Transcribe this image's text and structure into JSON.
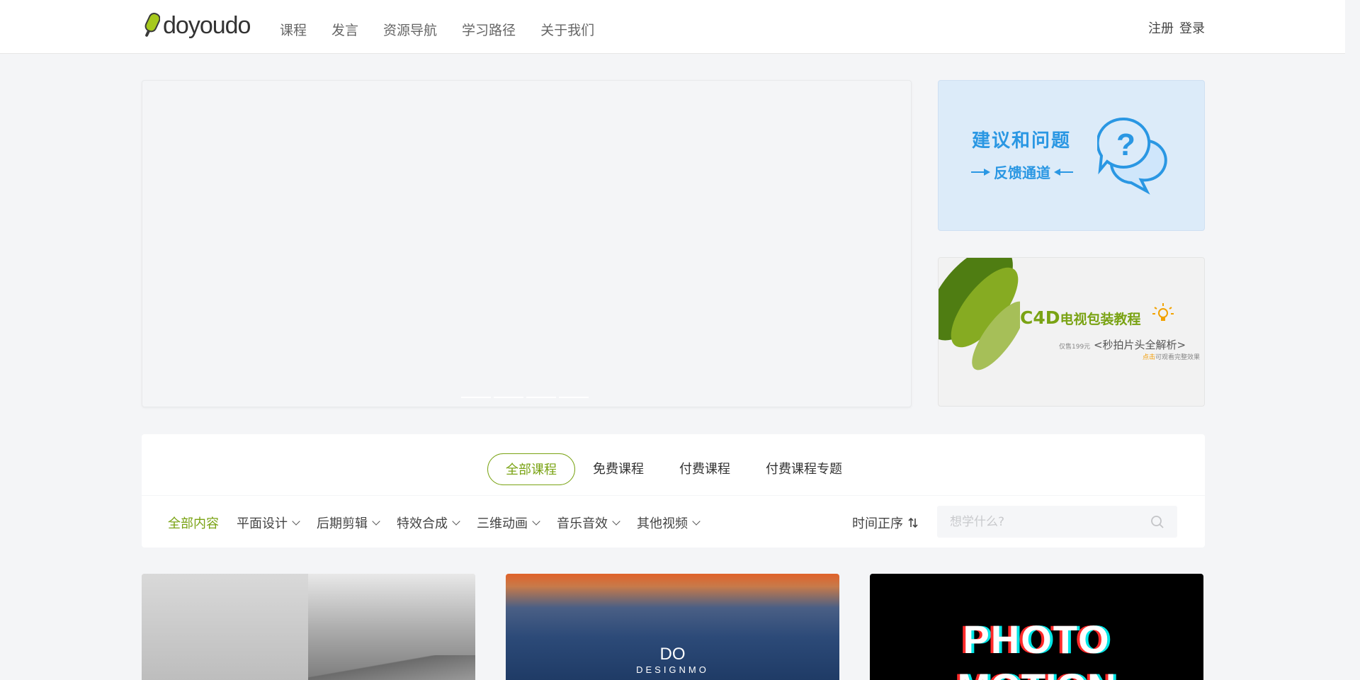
{
  "brand": {
    "logo_text": "doyoudo",
    "accent": "#7aa314"
  },
  "nav": {
    "items": [
      "课程",
      "发言",
      "资源导航",
      "学习路径",
      "关于我们"
    ]
  },
  "auth": {
    "register": "注册",
    "login": "登录"
  },
  "side_ads": {
    "feedback": {
      "title": "建议和问题",
      "subtitle": "反馈通道",
      "color": "#2a97e3"
    },
    "c4d": {
      "title_prefix": "C4D",
      "title_suffix": "电视包装教程",
      "price_small": "仅售199元",
      "price_main": "<秒拍片头全解析>",
      "note_highlight": "点击",
      "note_rest": "可观看完整效果"
    }
  },
  "tabs": [
    "全部课程",
    "免费课程",
    "付费课程",
    "付费课程专题"
  ],
  "categories": [
    "全部内容",
    "平面设计",
    "后期剪辑",
    "特效合成",
    "三维动画",
    "音乐音效",
    "其他视频"
  ],
  "sort": {
    "label": "时间正序",
    "icon": "sort-icon"
  },
  "search": {
    "placeholder": "想学什么?"
  },
  "cards": {
    "card2": {
      "title": "DO",
      "subtitle": "DESIGNMO"
    },
    "card3": {
      "title_line1": "PHOTO",
      "title_line2": "MOTION"
    }
  }
}
